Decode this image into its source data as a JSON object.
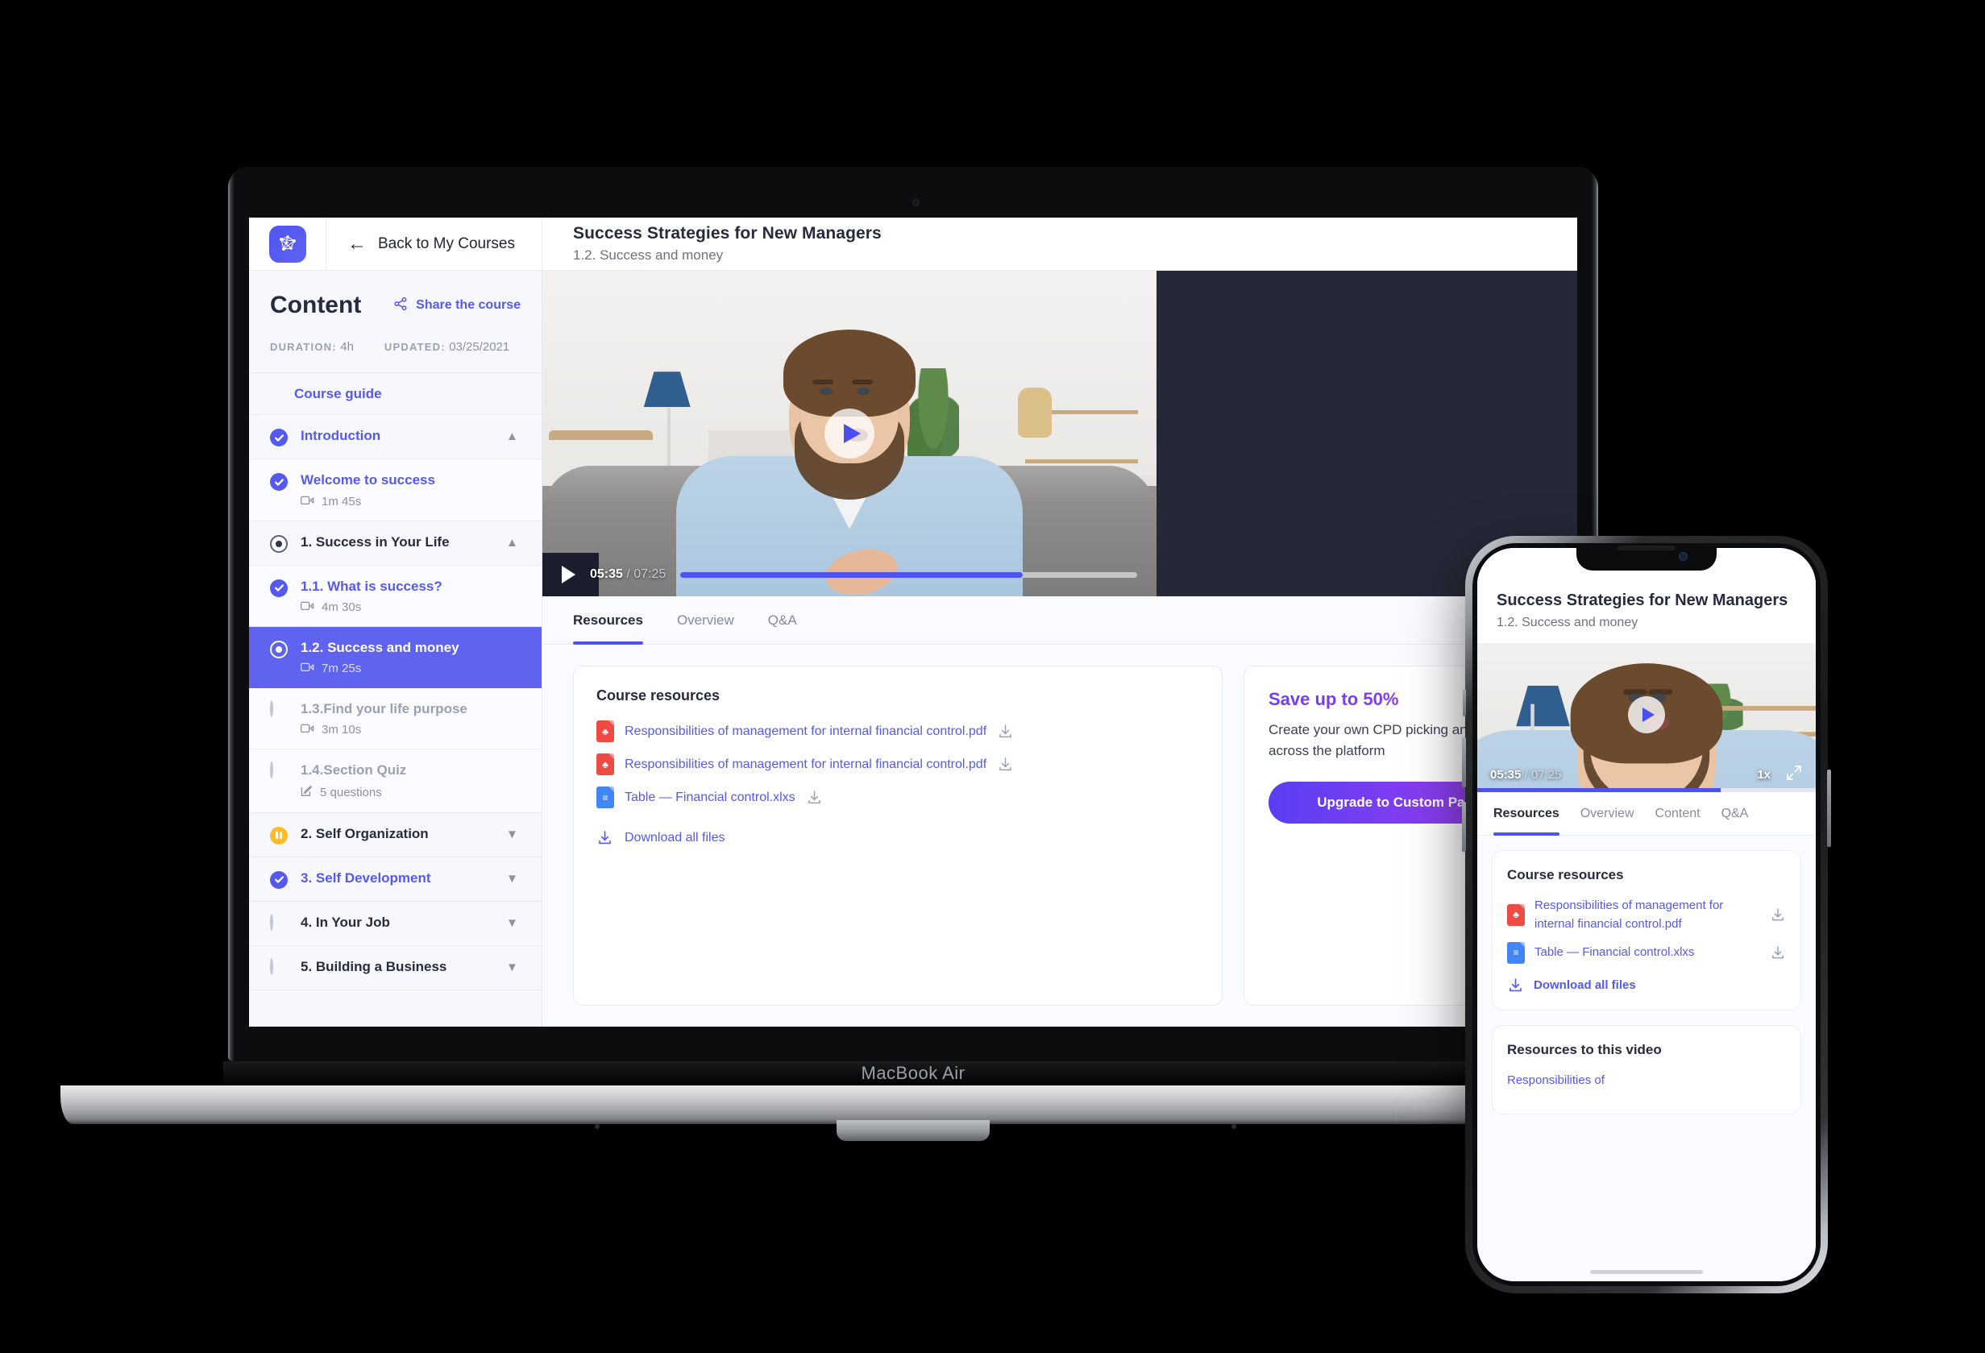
{
  "device": {
    "laptop_label": "MacBook Air"
  },
  "topbar": {
    "logo_icon": "network-logo-icon",
    "back_icon": "arrow-left-icon",
    "back_label": "Back to My Courses",
    "course_title": "Success Strategies for New Managers",
    "lesson_subtitle": "1.2. Success and money"
  },
  "sidebar": {
    "title": "Content",
    "share_icon": "share-icon",
    "share_label": "Share the course",
    "duration_label": "DURATION:",
    "duration_value": "4h",
    "updated_label": "UPDATED:",
    "updated_value": "03/25/2021",
    "course_guide_label": "Course guide",
    "items": [
      {
        "label": "Introduction",
        "state": "check",
        "style": "blue",
        "chevron": "chevron-up-icon",
        "section": true
      },
      {
        "label": "Welcome to success",
        "state": "check",
        "style": "blue",
        "meta_icon": "video-icon",
        "meta": "1m 45s"
      },
      {
        "label": "1. Success in Your Life",
        "state": "dot",
        "style": "dark",
        "chevron": "chevron-up-icon",
        "section": true
      },
      {
        "label": "1.1. What is success?",
        "state": "check",
        "style": "blue",
        "meta_icon": "video-icon",
        "meta": "4m 30s"
      },
      {
        "label": "1.2. Success and money",
        "state": "dot",
        "style": "active",
        "meta_icon": "video-icon",
        "meta": "7m 25s",
        "active": true
      },
      {
        "label": "1.3.Find your life purpose",
        "state": "empty",
        "style": "grey",
        "meta_icon": "video-icon",
        "meta": "3m 10s"
      },
      {
        "label": "1.4.Section Quiz",
        "state": "empty",
        "style": "grey",
        "meta_icon": "quiz-icon",
        "meta": "5 questions"
      },
      {
        "label": "2. Self Organization",
        "state": "pause",
        "style": "dark",
        "chevron": "chevron-down-icon",
        "section": true
      },
      {
        "label": "3. Self Development",
        "state": "check",
        "style": "blue",
        "chevron": "chevron-down-icon",
        "section": true
      },
      {
        "label": "4. In Your Job",
        "state": "empty",
        "style": "dark",
        "chevron": "chevron-down-icon",
        "section": true
      },
      {
        "label": "5. Building a Business",
        "state": "empty",
        "style": "dark",
        "chevron": "chevron-down-icon",
        "section": true
      }
    ]
  },
  "player": {
    "play_icon": "play-icon",
    "current_time": "05:35",
    "separator": " / ",
    "total_time": "07:25",
    "progress_percent": 75
  },
  "tabs": [
    {
      "label": "Resources",
      "active": true
    },
    {
      "label": "Overview",
      "active": false
    },
    {
      "label": "Q&A",
      "active": false
    }
  ],
  "resources": {
    "title": "Course resources",
    "files": [
      {
        "name": "Responsibilities of management for internal financial control.pdf",
        "type": "pdf",
        "download_icon": "download-icon"
      },
      {
        "name": "Responsibilities of management for internal financial control.pdf",
        "type": "pdf",
        "download_icon": "download-icon"
      },
      {
        "name": "Table — Financial control.xlxs",
        "type": "xls",
        "download_icon": "download-icon"
      }
    ],
    "download_all_icon": "download-icon",
    "download_all_label": "Download all files"
  },
  "promo": {
    "headline": "Save up to 50%",
    "body": "Create your own CPD picking any courses across the platform",
    "button_label": "Upgrade to Custom Package"
  },
  "phone": {
    "course_title": "Success Strategies for New Managers",
    "lesson_subtitle": "1.2. Success and money",
    "play_icon": "play-icon",
    "current_time": "05:35",
    "separator": " / ",
    "total_time": "07:25",
    "speed": "1x",
    "fullscreen_icon": "fullscreen-icon",
    "progress_percent": 72,
    "tabs": [
      {
        "label": "Resources",
        "active": true
      },
      {
        "label": "Overview",
        "active": false
      },
      {
        "label": "Content",
        "active": false
      },
      {
        "label": "Q&A",
        "active": false
      }
    ],
    "resources_title": "Course resources",
    "files": [
      {
        "name": "Responsibilities of management for internal financial control.pdf",
        "type": "pdf",
        "download_icon": "download-icon"
      },
      {
        "name": "Table — Financial control.xlxs",
        "type": "xls",
        "download_icon": "download-icon"
      }
    ],
    "download_all_label": "Download all files",
    "video_resources_title": "Resources to this video",
    "video_resource_first": "Responsibilities of"
  },
  "colors": {
    "accent": "#5559ef",
    "accent_strong": "#5052f0",
    "active_row": "#5f63ef",
    "pause_amber": "#fcbc23",
    "pdf_red": "#ee4b45",
    "xls_blue": "#4285f4",
    "promo_purple": "#8a3df0",
    "video_letterbox": "#252836"
  }
}
